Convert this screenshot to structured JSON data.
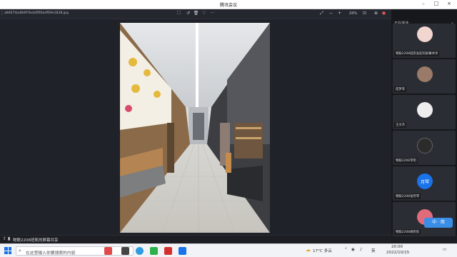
{
  "window": {
    "title": "腾讯会议"
  },
  "viewer": {
    "filename": "a84674ad8497bcb0f60a4f69e1838.jpg",
    "zoom": "24%",
    "tools": [
      "crop-icon",
      "rotate-left-icon",
      "delete-icon",
      "favorite-icon",
      "more-icon"
    ]
  },
  "sidebar": {
    "speaking_label": "正在讲话:",
    "participants": [
      {
        "name": "物联2208班凯发起的屏幕共享",
        "icon": "avatar-photo-icon"
      },
      {
        "name": "庞梦菲",
        "icon": "avatar-photo-icon"
      },
      {
        "name": "王文杰",
        "icon": "avatar-photo-icon"
      },
      {
        "name": "物联2208李明",
        "icon": "avatar-photo-icon"
      },
      {
        "name": "物联2208张月琴",
        "icon": "avatar-initials-icon",
        "initials": "月琴"
      },
      {
        "name": "物联2208胡明亮",
        "icon": "avatar-photo-icon"
      }
    ]
  },
  "share_bar": {
    "text": "物联2208班凯的屏幕共享"
  },
  "taskbar": {
    "search_placeholder": "在这里输入你要搜索的内容",
    "weather": "17°C 多云",
    "ime": "英",
    "time": "20:00",
    "date": "2022/10/15"
  },
  "colors": {
    "accent": "#1a73e8",
    "sidebar_bg": "#16181c",
    "main_bg": "#1f2228"
  }
}
